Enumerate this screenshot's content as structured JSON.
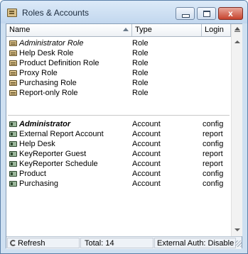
{
  "window": {
    "title": "Roles & Accounts",
    "close_label": "x"
  },
  "columns": {
    "name": "Name",
    "type": "Type",
    "login": "Login"
  },
  "roles": [
    {
      "name": "Administrator Role",
      "type": "Role",
      "style": "italic"
    },
    {
      "name": "Help Desk Role",
      "type": "Role"
    },
    {
      "name": "Product Definition Role",
      "type": "Role"
    },
    {
      "name": "Proxy Role",
      "type": "Role"
    },
    {
      "name": "Purchasing Role",
      "type": "Role"
    },
    {
      "name": "Report-only Role",
      "type": "Role"
    }
  ],
  "accounts": [
    {
      "name": "Administrator",
      "type": "Account",
      "login": "config",
      "style": "bolditalic"
    },
    {
      "name": "External Report Account",
      "type": "Account",
      "login": "report"
    },
    {
      "name": "Help Desk",
      "type": "Account",
      "login": "config"
    },
    {
      "name": "KeyReporter Guest",
      "type": "Account",
      "login": "report"
    },
    {
      "name": "KeyReporter Schedule",
      "type": "Account",
      "login": "report"
    },
    {
      "name": "Product",
      "type": "Account",
      "login": "config"
    },
    {
      "name": "Purchasing",
      "type": "Account",
      "login": "config"
    }
  ],
  "status": {
    "refresh": "Refresh",
    "total": "Total: 14",
    "external_auth": "External Auth: Disable"
  }
}
